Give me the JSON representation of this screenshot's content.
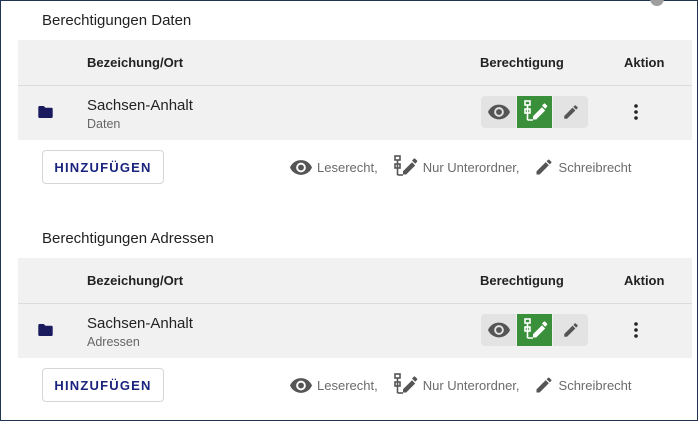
{
  "sections": [
    {
      "title": "Berechtigungen Daten",
      "columns": {
        "name": "Bezeichung/Ort",
        "permission": "Berechtigung",
        "action": "Aktion"
      },
      "row": {
        "title": "Sachsen-Anhalt",
        "subtitle": "Daten",
        "active_permission": "nur-unterordner"
      },
      "add_label": "HINZUFÜGEN",
      "legend": {
        "read": "Leserecht,",
        "subfolders": "Nur Unterordner,",
        "write": "Schreibrecht"
      }
    },
    {
      "title": "Berechtigungen Adressen",
      "columns": {
        "name": "Bezeichung/Ort",
        "permission": "Berechtigung",
        "action": "Aktion"
      },
      "row": {
        "title": "Sachsen-Anhalt",
        "subtitle": "Adressen",
        "active_permission": "nur-unterordner"
      },
      "add_label": "HINZUFÜGEN",
      "legend": {
        "read": "Leserecht,",
        "subfolders": "Nur Unterordner,",
        "write": "Schreibrecht"
      }
    }
  ],
  "colors": {
    "active": "#3a8f3a",
    "button_bg": "#e3e3e3",
    "icon": "#555555",
    "primary_text": "#1a237e"
  },
  "icons": [
    "folder-icon",
    "eye-icon",
    "subfolder-edit-icon",
    "pencil-icon",
    "more-vert-icon"
  ]
}
